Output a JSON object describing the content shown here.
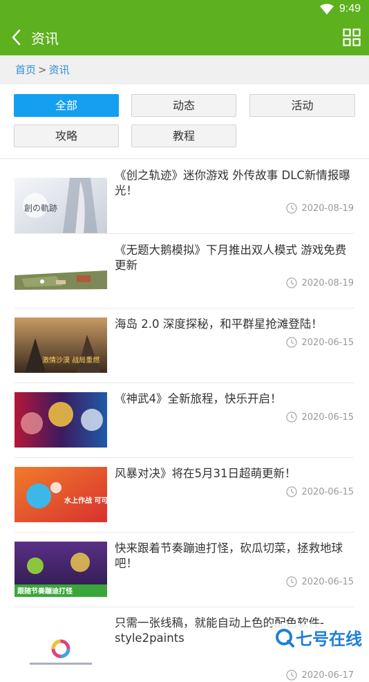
{
  "status": {
    "time": "9:49"
  },
  "header": {
    "title": "资讯"
  },
  "breadcrumb": {
    "home": "首页",
    "separator": ">",
    "current": "资讯"
  },
  "tabs": [
    {
      "label": "全部",
      "active": true
    },
    {
      "label": "动态",
      "active": false
    },
    {
      "label": "活动",
      "active": false
    },
    {
      "label": "攻略",
      "active": false
    },
    {
      "label": "教程",
      "active": false
    }
  ],
  "articles": [
    {
      "title": "《创之轨迹》迷你游戏 外传故事 DLC新情报曝光！",
      "date": "2020-08-19",
      "thumb_text": "創の軌跡"
    },
    {
      "title": "《无题大鹅模拟》下月推出双人模式 游戏免费更新",
      "date": "2020-08-19",
      "thumb_text": ""
    },
    {
      "title": "海岛 2.0 深度探秘，和平群星抢滩登陆！",
      "date": "2020-06-15",
      "thumb_text": "激情沙漠 战局重燃"
    },
    {
      "title": "《神武4》全新旅程，快乐开启！",
      "date": "2020-06-15",
      "thumb_text": ""
    },
    {
      "title": "风暴对决》将在5月31日超萌更新！",
      "date": "2020-06-15",
      "thumb_text": "水上作战 可可可狼!"
    },
    {
      "title": "快来跟着节奏蹦迪打怪，砍瓜切菜，拯救地球吧！",
      "date": "2020-06-15",
      "thumb_text": "跟随节奏蹦迪打怪"
    },
    {
      "title": "只需一张线稿，就能自动上色的配色软件-style2paints",
      "date": "2020-06-17",
      "thumb_text": ""
    }
  ],
  "watermark": {
    "text": "七号在线"
  },
  "colors": {
    "brand_green": "#5db01e",
    "active_tab": "#149ff0",
    "link_blue": "#2b90d9"
  }
}
